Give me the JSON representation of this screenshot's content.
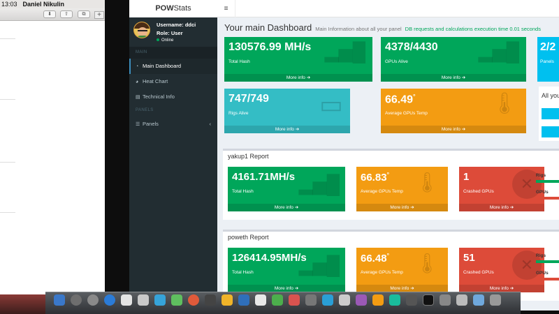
{
  "menubar": {
    "time": "13:03",
    "user": "Daniel Nikulin"
  },
  "browser": {
    "new_tab_symbol": "+"
  },
  "app": {
    "logo_bold": "POW",
    "logo_rest": "Stats",
    "menu_symbol": "≡"
  },
  "user": {
    "username": "Username: ddci",
    "role": "Role: User",
    "status": "Online"
  },
  "sidebar": {
    "main_header": "MAIN",
    "items": [
      {
        "label": "Main Dashboard",
        "icon": "dashboard-icon"
      },
      {
        "label": "Heat Chart",
        "icon": "pie-chart-icon"
      },
      {
        "label": "Technical Info",
        "icon": "database-icon"
      }
    ],
    "panels_header": "PANELS",
    "panels_item": {
      "label": "Panels",
      "icon": "list-icon",
      "chevron": "‹"
    }
  },
  "page": {
    "title": "Your main Dashboard",
    "subtitle": "Main Information about all your panel",
    "db_note": "DB requests and calculations execution time 0.01 seconds"
  },
  "more_info": "More info ➔",
  "overview": [
    {
      "value": "130576.99 MH/s",
      "label": "Total Hash",
      "icon": "bar-chart-icon",
      "color": "#00a65a"
    },
    {
      "value": "4378/4430",
      "label": "GPUs Alive",
      "icon": "bar-chart-icon",
      "color": "#00a65a"
    },
    {
      "value": "2/2",
      "label": "Panels",
      "color": "#00c0ef"
    },
    {
      "value": "747/749",
      "label": "Rigs Alive",
      "icon": "monitor-icon",
      "color": "#34bdc5"
    },
    {
      "value": "66.49",
      "unit": "°",
      "label": "Average GPUs Temp",
      "icon": "thermometer-icon",
      "color": "#f39c12"
    }
  ],
  "side_card_text": "All you",
  "reports": [
    {
      "title": "yakup1 Report",
      "hash": "4161.71MH/s",
      "hash_label": "Total Hash",
      "temp": "66.83",
      "temp_unit": "°",
      "temp_label": "Average GPUs Temp",
      "crashed": "1",
      "crashed_label": "Crashed GPUs",
      "rigs_label": "Rigs",
      "gpus_label": "GPUs"
    },
    {
      "title": "poweth Report",
      "hash": "126414.95MH/s",
      "hash_label": "Total Hash",
      "temp": "66.48",
      "temp_unit": "°",
      "temp_label": "Average GPUs Temp",
      "crashed": "51",
      "crashed_label": "Crashed GPUs",
      "rigs_label": "Rigs",
      "gpus_label": "GPUs"
    }
  ],
  "colors": {
    "sidebar": "#222d32",
    "green": "#00a65a",
    "orange": "#f39c12",
    "red": "#dd4b39",
    "aqua": "#00c0ef",
    "teal": "#34bdc5"
  }
}
